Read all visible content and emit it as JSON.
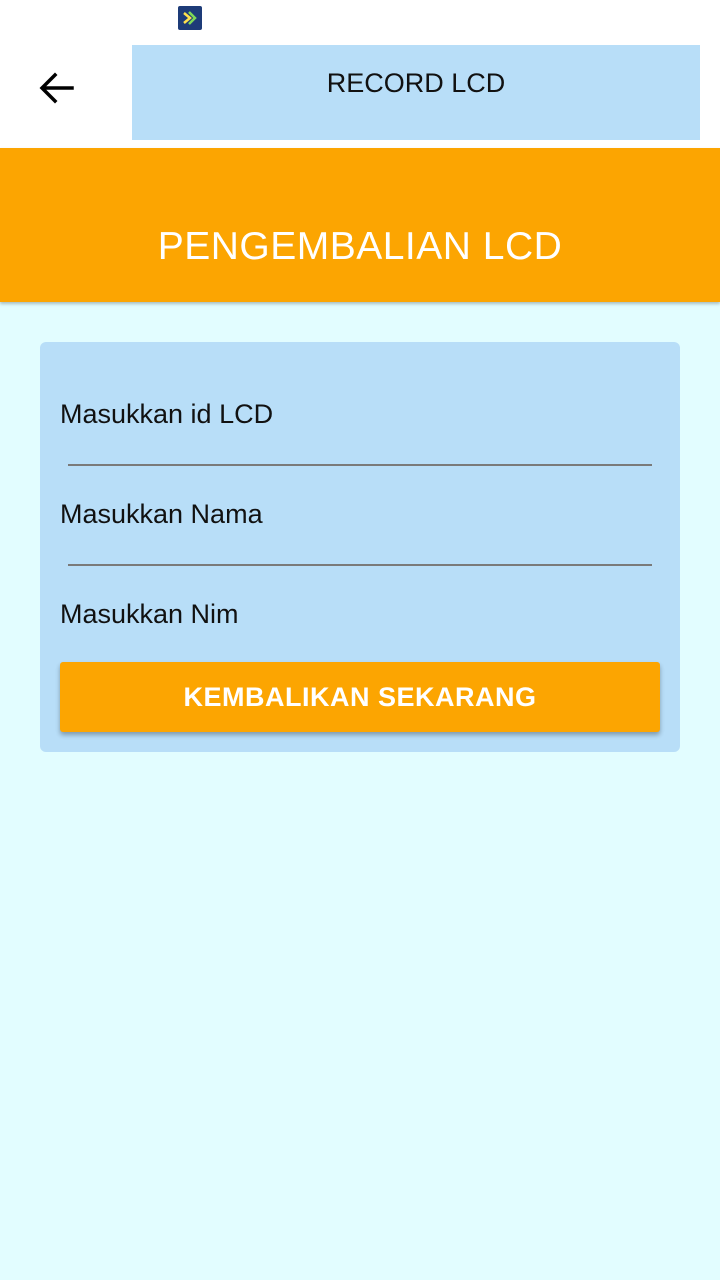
{
  "status_bar": {
    "carrier_icon": "xl-carrier-icon"
  },
  "app_bar": {
    "back_icon": "arrow-left-icon",
    "record_label": "RECORD LCD"
  },
  "header": {
    "title": "PENGEMBALIAN LCD"
  },
  "form": {
    "fields": [
      {
        "placeholder": "Masukkan id LCD",
        "value": ""
      },
      {
        "placeholder": "Masukkan Nama",
        "value": ""
      },
      {
        "placeholder": "Masukkan Nim",
        "value": ""
      }
    ],
    "submit_label": "KEMBALIKAN SEKARANG"
  },
  "colors": {
    "accent": "#fca501",
    "card": "#b8def8",
    "background": "#e2fdff"
  }
}
